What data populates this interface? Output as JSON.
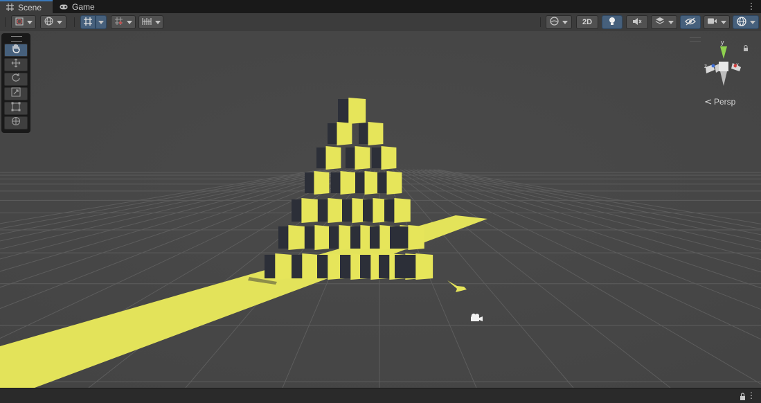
{
  "tabs": [
    {
      "label": "Scene",
      "icon": "grid-icon",
      "active": true
    },
    {
      "label": "Game",
      "icon": "gamepad-icon",
      "active": false
    }
  ],
  "toolbar": {
    "mode_2d_label": "2D"
  },
  "tools": [
    {
      "name": "hand-tool",
      "icon": "hand-icon",
      "active": true
    },
    {
      "name": "move-tool",
      "icon": "move-arrows-icon",
      "active": false
    },
    {
      "name": "rotate-tool",
      "icon": "rotate-icon",
      "active": false
    },
    {
      "name": "scale-tool",
      "icon": "scale-icon",
      "active": false
    },
    {
      "name": "rect-tool",
      "icon": "rect-icon",
      "active": false
    },
    {
      "name": "transform-tool",
      "icon": "transform-icon",
      "active": false
    }
  ],
  "gizmo": {
    "y_label": "y",
    "x_label": "x",
    "z_label": "z",
    "projection_label": "Persp"
  },
  "colors": {
    "accent": "#46607c",
    "yellow": "#e6e55a",
    "viewport": "#474747"
  }
}
